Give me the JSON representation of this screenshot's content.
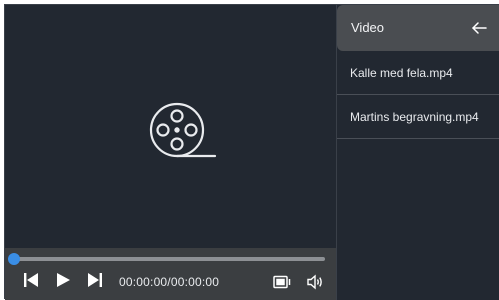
{
  "player": {
    "time_display": "00:00:00/00:00:00",
    "progress": 0.0,
    "accent_color": "#3a8ee6",
    "placeholder_icon": "film-reel-icon",
    "controls": {
      "previous_icon": "skip-previous-icon",
      "play_icon": "play-icon",
      "next_icon": "skip-next-icon",
      "pip_icon": "picture-in-picture-icon",
      "volume_icon": "volume-icon"
    }
  },
  "sidebar": {
    "title": "Video",
    "back_icon": "arrow-left-icon",
    "files": [
      {
        "label": "Kalle med fela.mp4"
      },
      {
        "label": "Martins begravning.mp4"
      }
    ]
  }
}
